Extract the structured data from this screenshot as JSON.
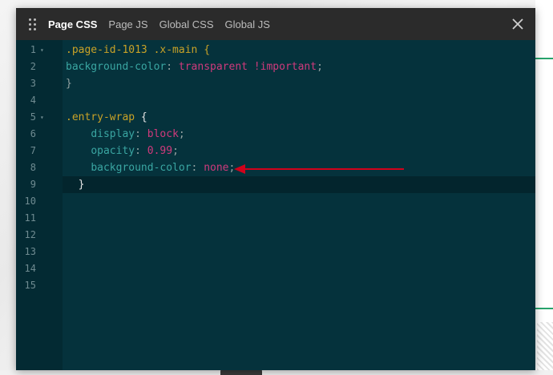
{
  "tabs": [
    {
      "label": "Page CSS",
      "active": true
    },
    {
      "label": "Page JS",
      "active": false
    },
    {
      "label": "Global CSS",
      "active": false
    },
    {
      "label": "Global JS",
      "active": false
    }
  ],
  "icons": {
    "drag": "drag-handle-icon",
    "close": "close-icon",
    "fold": "fold-arrow-icon",
    "annotation": "red-arrow-icon"
  },
  "colors": {
    "editor_bg": "#05323c",
    "header_bg": "#2b2b2b",
    "selector": "#c9a227",
    "property": "#3aa6a2",
    "value": "#cf3a7c",
    "arrow": "#d0021b"
  },
  "editor": {
    "line_numbers": [
      "1",
      "2",
      "3",
      "4",
      "5",
      "6",
      "7",
      "8",
      "9",
      "10",
      "11",
      "12",
      "13",
      "14",
      "15"
    ],
    "fold_marker": "▾",
    "active_line": 9,
    "lines": {
      "l1": {
        "selector": ".page-id-1013 .x-main",
        "brace": "{"
      },
      "l2": {
        "property": "background-color",
        "colon": ":",
        "value": "transparent !important",
        "semi": ";"
      },
      "l3": {
        "brace": "}"
      },
      "l5": {
        "selector": ".entry-wrap",
        "brace": "{"
      },
      "l6": {
        "property": "display",
        "colon": ":",
        "value": "block",
        "semi": ";"
      },
      "l7": {
        "property": "opacity",
        "colon": ":",
        "value": "0.99",
        "semi": ";"
      },
      "l8": {
        "property": "background-color",
        "colon": ":",
        "value": "none",
        "semi": ";"
      },
      "l9": {
        "brace": "}"
      }
    }
  }
}
